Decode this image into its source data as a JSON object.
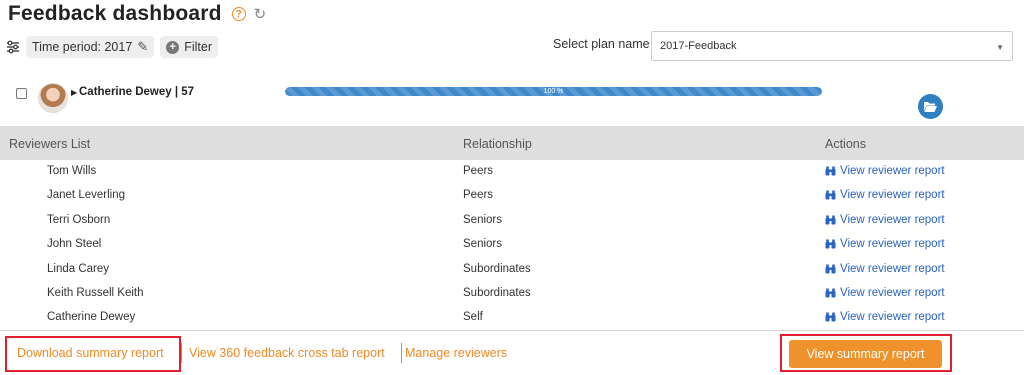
{
  "header": {
    "title": "Feedback dashboard",
    "help_icon": "question-circle-icon",
    "refresh_icon": "refresh-icon"
  },
  "toolbar": {
    "time_period_label": "Time period: 2017",
    "filter_label": "Filter"
  },
  "plan": {
    "label": "Select plan name",
    "selected": "2017-Feedback"
  },
  "employee": {
    "name": "Catherine Dewey | 57",
    "progress_percent": 100,
    "progress_label": "100 %"
  },
  "table": {
    "columns": [
      "Reviewers List",
      "Relationship",
      "Actions"
    ],
    "rows": [
      {
        "name": "Tom Wills",
        "relationship": "Peers",
        "action": "View reviewer report"
      },
      {
        "name": "Janet Leverling",
        "relationship": "Peers",
        "action": "View reviewer report"
      },
      {
        "name": "Terri Osborn",
        "relationship": "Seniors",
        "action": "View reviewer report"
      },
      {
        "name": "John Steel",
        "relationship": "Seniors",
        "action": "View reviewer report"
      },
      {
        "name": "Linda Carey",
        "relationship": "Subordinates",
        "action": "View reviewer report"
      },
      {
        "name": "Keith Russell Keith",
        "relationship": "Subordinates",
        "action": "View reviewer report"
      },
      {
        "name": "Catherine Dewey",
        "relationship": "Self",
        "action": "View reviewer report"
      }
    ]
  },
  "footer": {
    "download_summary": "Download summary report",
    "cross_tab": "View 360 feedback cross tab report",
    "manage_reviewers": "Manage reviewers",
    "view_summary": "View summary report"
  },
  "colors": {
    "accent_orange": "#f08a24",
    "link_blue": "#2b63c0",
    "progress_blue": "#3f88c9",
    "highlight_red": "#e0202c"
  }
}
